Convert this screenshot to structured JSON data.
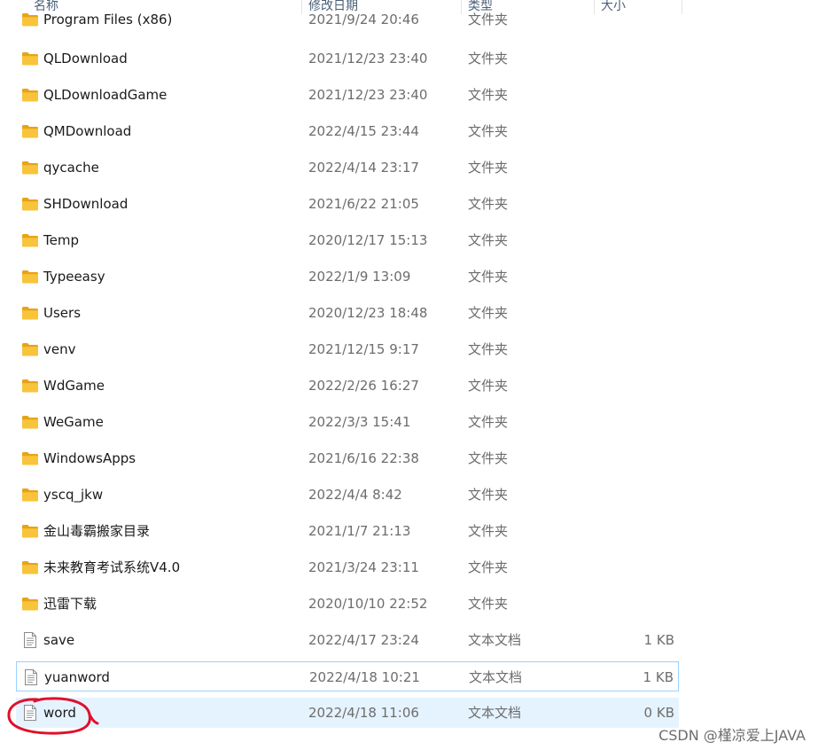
{
  "columns": {
    "name": "名称",
    "modified": "修改日期",
    "type": "类型",
    "size": "大小"
  },
  "files": [
    {
      "name": "Program Files (x86)",
      "modified": "2021/9/24 20:46",
      "type": "文件夹",
      "size": "",
      "icon": "folder-icon"
    },
    {
      "name": "QLDownload",
      "modified": "2021/12/23 23:40",
      "type": "文件夹",
      "size": "",
      "icon": "folder-icon"
    },
    {
      "name": "QLDownloadGame",
      "modified": "2021/12/23 23:40",
      "type": "文件夹",
      "size": "",
      "icon": "folder-icon"
    },
    {
      "name": "QMDownload",
      "modified": "2022/4/15 23:44",
      "type": "文件夹",
      "size": "",
      "icon": "folder-icon"
    },
    {
      "name": "qycache",
      "modified": "2022/4/14 23:17",
      "type": "文件夹",
      "size": "",
      "icon": "folder-icon"
    },
    {
      "name": "SHDownload",
      "modified": "2021/6/22 21:05",
      "type": "文件夹",
      "size": "",
      "icon": "folder-icon"
    },
    {
      "name": "Temp",
      "modified": "2020/12/17 15:13",
      "type": "文件夹",
      "size": "",
      "icon": "folder-icon"
    },
    {
      "name": "Typeeasy",
      "modified": "2022/1/9 13:09",
      "type": "文件夹",
      "size": "",
      "icon": "folder-icon"
    },
    {
      "name": "Users",
      "modified": "2020/12/23 18:48",
      "type": "文件夹",
      "size": "",
      "icon": "folder-icon"
    },
    {
      "name": "venv",
      "modified": "2021/12/15 9:17",
      "type": "文件夹",
      "size": "",
      "icon": "folder-icon"
    },
    {
      "name": "WdGame",
      "modified": "2022/2/26 16:27",
      "type": "文件夹",
      "size": "",
      "icon": "folder-icon"
    },
    {
      "name": "WeGame",
      "modified": "2022/3/3 15:41",
      "type": "文件夹",
      "size": "",
      "icon": "folder-icon"
    },
    {
      "name": "WindowsApps",
      "modified": "2021/6/16 22:38",
      "type": "文件夹",
      "size": "",
      "icon": "folder-icon"
    },
    {
      "name": "yscq_jkw",
      "modified": "2022/4/4 8:42",
      "type": "文件夹",
      "size": "",
      "icon": "folder-icon"
    },
    {
      "name": "金山毒霸搬家目录",
      "modified": "2021/1/7 21:13",
      "type": "文件夹",
      "size": "",
      "icon": "folder-icon"
    },
    {
      "name": "未来教育考试系统V4.0",
      "modified": "2021/3/24 23:11",
      "type": "文件夹",
      "size": "",
      "icon": "folder-icon"
    },
    {
      "name": "迅雷下载",
      "modified": "2020/10/10 22:52",
      "type": "文件夹",
      "size": "",
      "icon": "folder-icon"
    },
    {
      "name": "save",
      "modified": "2022/4/17 23:24",
      "type": "文本文档",
      "size": "1 KB",
      "icon": "text-file-icon"
    },
    {
      "name": "yuanword",
      "modified": "2022/4/18 10:21",
      "type": "文本文档",
      "size": "1 KB",
      "icon": "text-file-icon",
      "state": "focused"
    },
    {
      "name": "word",
      "modified": "2022/4/18 11:06",
      "type": "文本文档",
      "size": "0 KB",
      "icon": "text-file-icon",
      "state": "selected"
    }
  ],
  "watermark": "CSDN @槿凉爱上JAVA",
  "colors": {
    "folder": "#f8c43c",
    "selection": "#e5f3ff",
    "focus_border": "#99d1ff",
    "annotation": "#e0102a"
  }
}
